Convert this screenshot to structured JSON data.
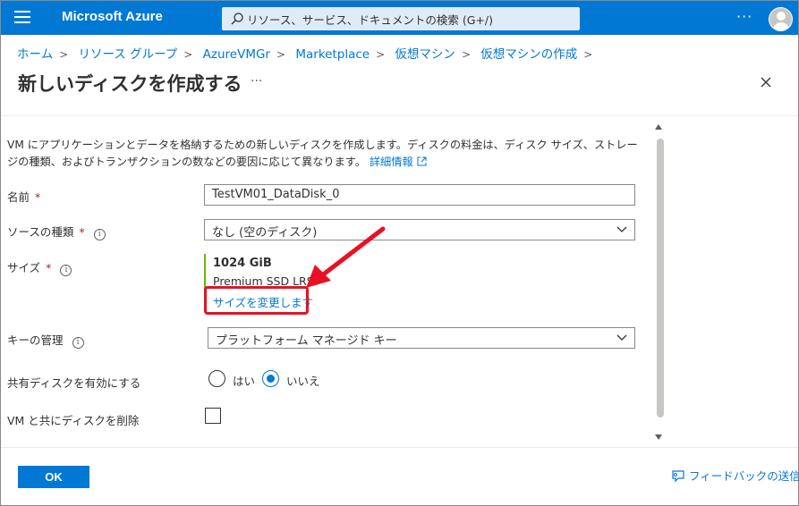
{
  "topbar": {
    "brand": "Microsoft Azure",
    "search_placeholder": "リソース、サービス、ドキュメントの検索 (G+/)",
    "more": "···"
  },
  "breadcrumb": [
    "ホーム",
    "リソース グループ",
    "AzureVMGr",
    "Marketplace",
    "仮想マシン",
    "仮想マシンの作成"
  ],
  "page": {
    "title": "新しいディスクを作成する",
    "more": "···"
  },
  "description": {
    "text": "VM にアプリケーションとデータを格納するための新しいディスクを作成します。ディスクの料金は、ディスク サイズ、ストレージの種類、およびトランザクションの数などの要因に応じて異なります。",
    "link": "詳細情報"
  },
  "form": {
    "name_label": "名前",
    "name_value": "TestVM01_DataDisk_0",
    "source_label": "ソースの種類",
    "source_value": "なし (空のディスク)",
    "size_label": "サイズ",
    "size_value": "1024 GiB",
    "size_type": "Premium SSD LRS",
    "size_change_link": "サイズを変更します",
    "key_label": "キーの管理",
    "key_value": "プラットフォーム マネージド キー",
    "shared_label": "共有ディスクを有効にする",
    "shared_yes": "はい",
    "shared_no": "いいえ",
    "shared_selected": "いいえ",
    "delete_label": "VM と共にディスクを削除",
    "delete_checked": false,
    "required_mark": "*",
    "info_mark": "i"
  },
  "footer": {
    "ok_label": "OK",
    "feedback_label": "フィードバックの送信"
  },
  "colors": {
    "accent": "#0078d4",
    "annotation": "#e81123",
    "size_bar": "#6bb700"
  }
}
